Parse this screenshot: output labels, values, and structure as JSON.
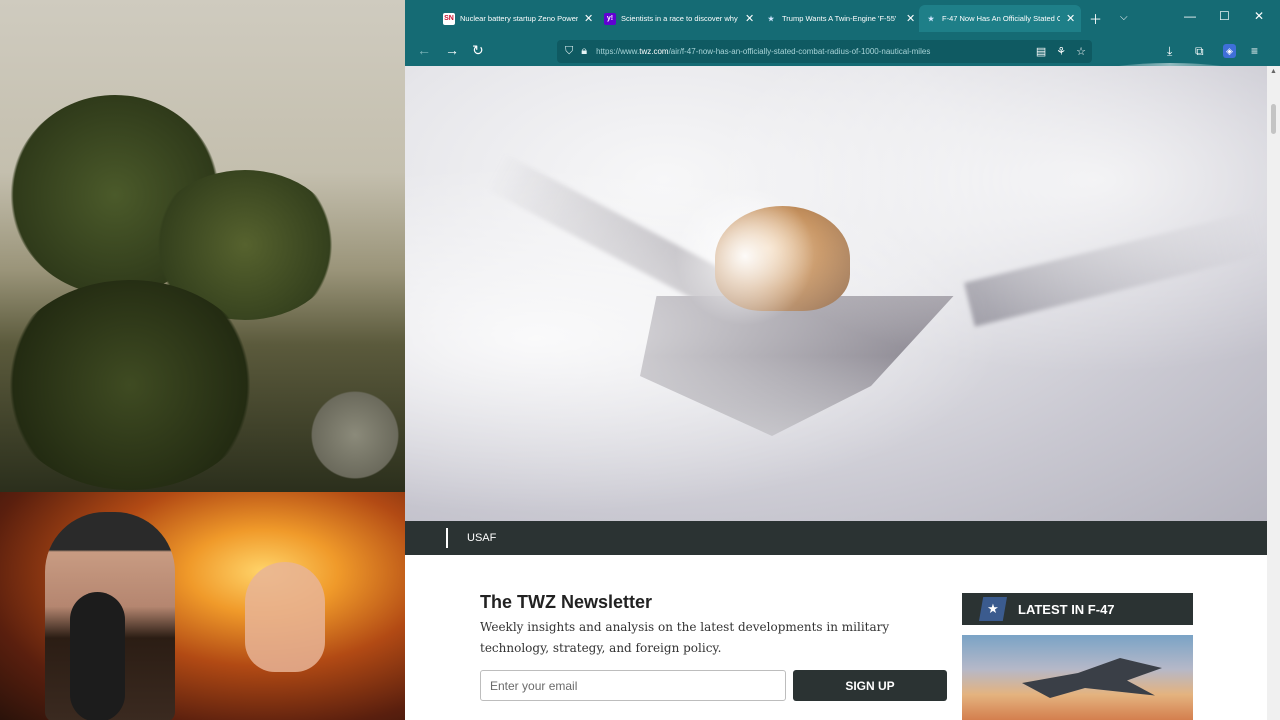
{
  "browser": {
    "tabs": [
      {
        "favicon": "SN",
        "title": "Nuclear battery startup Zeno Power",
        "active": false
      },
      {
        "favicon": "y!",
        "title": "Scientists in a race to discover why",
        "active": false
      },
      {
        "favicon": "★",
        "title": "Trump Wants A Twin-Engine 'F-55'",
        "active": false
      },
      {
        "favicon": "★",
        "title": "F-47 Now Has An Officially Stated C",
        "active": true
      }
    ],
    "url_prefix": "https://www.",
    "url_domain": "twz.com",
    "url_path": "/air/f-47-now-has-an-officially-stated-combat-radius-of-1000-nautical-miles"
  },
  "article": {
    "hero_caption": "USAF"
  },
  "newsletter": {
    "title": "The TWZ Newsletter",
    "description": "Weekly insights and analysis on the latest developments in military technology, strategy, and foreign policy.",
    "email_placeholder": "Enter your email",
    "signup_label": "SIGN UP"
  },
  "sidebar": {
    "latest_label": "LATEST IN F-47"
  },
  "colors": {
    "chrome": "#156b74",
    "dark_bar": "#2b3333",
    "accent_blue": "#3b5b8e"
  }
}
